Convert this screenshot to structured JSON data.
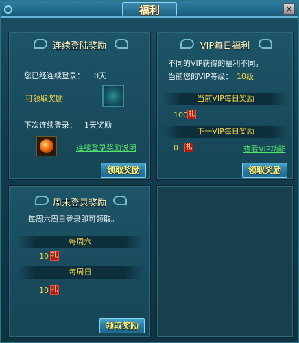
{
  "window": {
    "title": "福利",
    "close_icon": "×"
  },
  "login_panel": {
    "title": "连续登陆奖励",
    "days_label": "您已经连续登录：",
    "days_value": "0天",
    "claimable_label": "可领取奖励",
    "next_label": "下次连续登录：",
    "next_value": "1天奖励",
    "rules_link": "连续登录奖励说明",
    "claim_button": "领取奖励"
  },
  "vip_panel": {
    "title": "VIP每日福利",
    "desc1": "不同的VIP获得的福利不同。",
    "desc2_label": "当前您的VIP等级：",
    "desc2_value": "10级",
    "current_header": "当前VIP每日奖励",
    "current_amount": "100",
    "next_header": "下一VIP每日奖励",
    "next_amount": "0",
    "view_link": "查看VIP功能",
    "claim_button": "领取奖励",
    "gift_glyph": "礼"
  },
  "weekend_panel": {
    "title": "周末登录奖励",
    "desc": "每周六周日登录即可领取。",
    "sat_header": "每周六",
    "sat_amount": "10",
    "sun_header": "每周日",
    "sun_amount": "10",
    "claim_button": "领取奖励",
    "gift_glyph": "礼"
  }
}
